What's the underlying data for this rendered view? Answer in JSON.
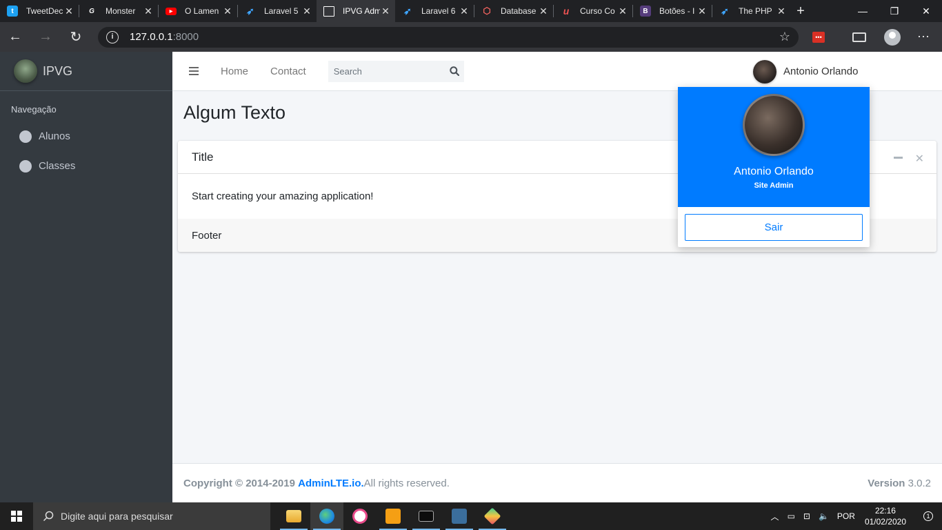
{
  "browser": {
    "tabs": [
      {
        "title": "TweetDeck",
        "favicon": "twitter-icon",
        "color": "#1da1f2"
      },
      {
        "title": "Monster",
        "favicon": "monster-icon",
        "color": "#ffffff"
      },
      {
        "title": "O Lamen",
        "favicon": "youtube-icon",
        "color": "#ff0000"
      },
      {
        "title": "Laravel 5",
        "favicon": "laracasts-icon",
        "color": "#3fa6ff"
      },
      {
        "title": "IPVG Adm",
        "favicon": "page-icon",
        "color": "#ffffff",
        "active": true
      },
      {
        "title": "Laravel 6",
        "favicon": "laracasts-icon",
        "color": "#3fa6ff"
      },
      {
        "title": "Database",
        "favicon": "laravel-icon",
        "color": "#f4645f"
      },
      {
        "title": "Curso Co",
        "favicon": "udemy-icon",
        "color": "#ec5252"
      },
      {
        "title": "Botões - I",
        "favicon": "bootstrap-icon",
        "color": "#563d7c"
      },
      {
        "title": "The PHP",
        "favicon": "laracasts-icon",
        "color": "#3fa6ff"
      }
    ],
    "url_host": "127.0.0.1",
    "url_port": ":8000"
  },
  "sidebar": {
    "brand": "IPVG",
    "nav_header": "Navegação",
    "items": [
      {
        "label": "Alunos"
      },
      {
        "label": "Classes"
      }
    ]
  },
  "topnav": {
    "links": [
      "Home",
      "Contact"
    ],
    "search_placeholder": "Search",
    "user_name": "Antonio Orlando"
  },
  "content": {
    "page_title": "Algum Texto",
    "card": {
      "title": "Title",
      "body": "Start creating your amazing application!",
      "footer": "Footer"
    }
  },
  "dropdown": {
    "name": "Antonio Orlando",
    "role": "Site Admin",
    "logout_label": "Sair"
  },
  "footer": {
    "copyright_prefix": "Copyright © 2014-2019 ",
    "brand_link": "AdminLTE.io.",
    "rights": " All rights reserved.",
    "version_label": "Version",
    "version_value": " 3.0.2"
  },
  "taskbar": {
    "search_placeholder": "Digite aqui para pesquisar",
    "language": "POR",
    "time": "22:16",
    "date": "01/02/2020",
    "notification_count": "1"
  },
  "colors": {
    "primary": "#007bff",
    "sidebar": "#343a40"
  }
}
